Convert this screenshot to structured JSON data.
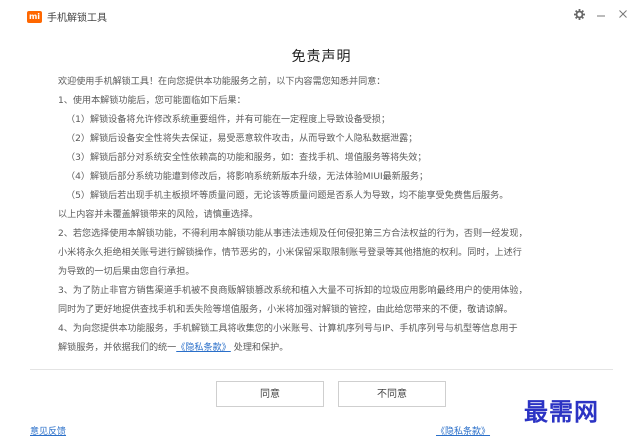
{
  "window": {
    "logo_text": "mi",
    "title": "手机解锁工具",
    "controls": [
      "gear-icon",
      "minimize-icon",
      "close-icon"
    ]
  },
  "heading": "免责声明",
  "paragraphs": [
    "欢迎使用手机解锁工具！在向您提供本功能服务之前，以下内容需您知悉并同意：",
    "1、使用本解锁功能后，您可能面临如下后果：",
    "（1）解锁设备将允许修改系统重要组件，并有可能在一定程度上导致设备受损；",
    "（2）解锁后设备安全性将失去保证，易受恶意软件攻击，从而导致个人隐私数据泄露；",
    "（3）解锁后部分对系统安全性依赖高的功能和服务，如：查找手机、增值服务等将失效；",
    "（4）解锁后部分系统功能遭到修改后，将影响系统新版本升级，无法体验MIUI最新服务；",
    "（5）解锁后若出现手机主板损坏等质量问题，无论该等质量问题是否系人为导致，均不能享受免费售后服务。",
    "以上内容并未覆盖解锁带来的风险，请慎重选择。",
    "2、若您选择使用本解锁功能，不得利用本解锁功能从事违法违规及任何侵犯第三方合法权益的行为，否则一经发现，",
    "小米将永久拒绝相关账号进行解锁操作，情节恶劣的，小米保留采取限制账号登录等其他措施的权利。同时，上述行",
    "为导致的一切后果由您自行承担。",
    "3、为了防止非官方销售渠道手机被不良商贩解锁篡改系统和植入大量不可拆卸的垃圾应用影响最终用户的使用体验，",
    "同时为了更好地提供查找手机和丢失险等增值服务，小米将加强对解锁的管控，由此给您带来的不便，敬请谅解。",
    "4、为向您提供本功能服务，手机解锁工具将收集您的小米账号、计算机序列号与IP、手机序列号与机型等信息用于",
    "解锁服务，并依据我们的统一"
  ],
  "privacy_link": "《隐私条款》",
  "tail_text": "处理和保护。",
  "buttons": {
    "agree": "同意",
    "disagree": "不同意"
  },
  "footer": {
    "feedback": "意见反馈",
    "privacy": "《隐私条款》"
  },
  "watermark": "最需网",
  "colors": {
    "brand": "#ff6700",
    "link": "#2a6fc9",
    "watermark": "#2b33c4"
  }
}
